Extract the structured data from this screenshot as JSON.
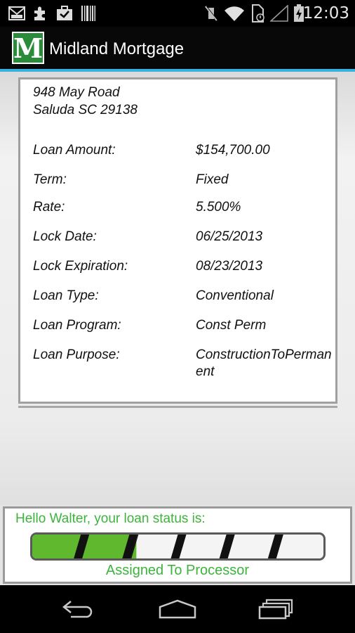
{
  "status_bar": {
    "time": "12:03",
    "left_icons": [
      "gmail-icon",
      "puzzle-icon",
      "briefcase-icon",
      "barcode-icon"
    ],
    "right_icons": [
      "vibrate-mute-icon",
      "wifi-icon",
      "sim-alert-icon",
      "signal-icon",
      "battery-charging-icon"
    ]
  },
  "app": {
    "logo_letter": "M",
    "title": "Midland Mortgage",
    "brand_color": "#2a8c3a",
    "accent_color": "#35b2e0"
  },
  "loan": {
    "address_line1": "948 May Road",
    "address_line2": "Saluda SC 29138",
    "rows": [
      {
        "label": "Loan Amount:",
        "value": "$154,700.00"
      },
      {
        "label": "Term:",
        "value": "Fixed"
      },
      {
        "label": "Rate:",
        "value": "5.500%"
      },
      {
        "label": "Lock Date:",
        "value": "06/25/2013"
      },
      {
        "label": "Lock Expiration:",
        "value": "08/23/2013"
      },
      {
        "label": "Loan Type:",
        "value": "Conventional"
      },
      {
        "label": "Loan Program:",
        "value": "Const Perm"
      },
      {
        "label": "Loan Purpose:",
        "value": "ConstructionToPermanent"
      }
    ]
  },
  "status": {
    "greeting": "Hello Walter, your loan status is:",
    "progress_segments_total": 6,
    "progress_segments_complete": 2,
    "progress_color": "#5fb82e",
    "status_text": "Assigned To Processor",
    "text_color": "#3cb43c"
  },
  "nav": {
    "icons": [
      "back-icon",
      "home-icon",
      "recent-apps-icon"
    ]
  }
}
